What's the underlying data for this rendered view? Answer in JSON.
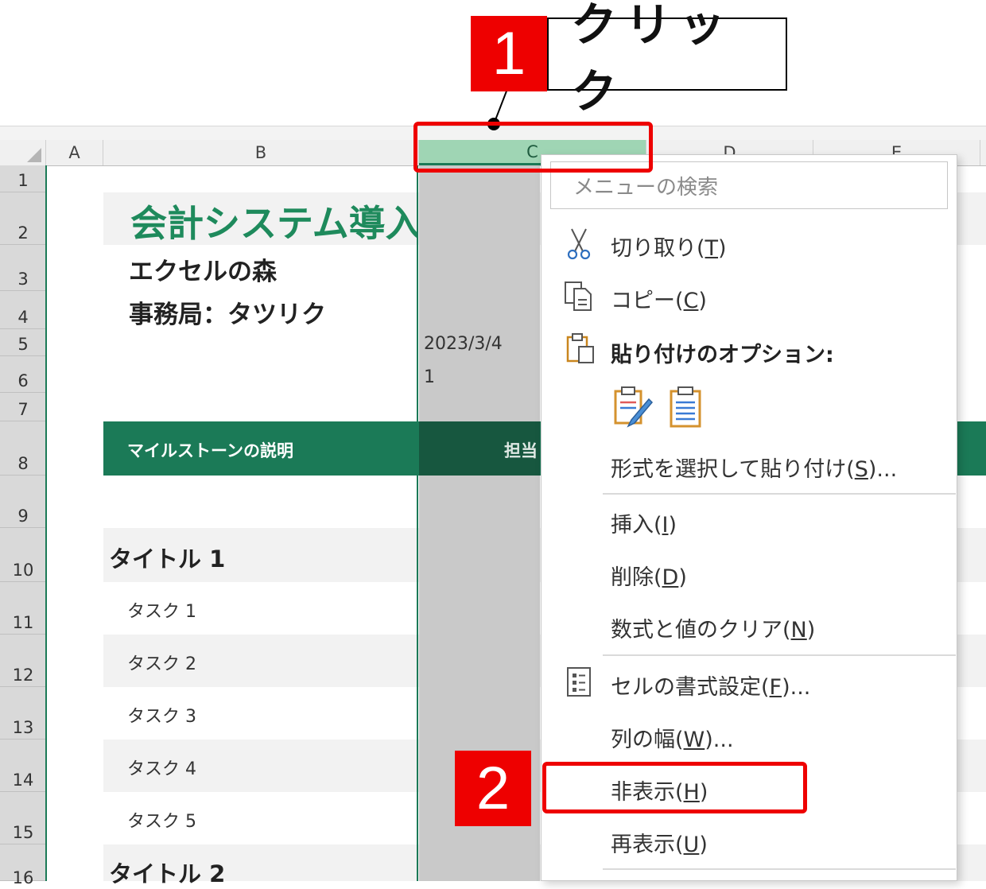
{
  "callouts": {
    "step1": "1",
    "step1_text": "クリック",
    "step2": "2"
  },
  "sheet": {
    "columns": [
      "A",
      "B",
      "C",
      "D",
      "E"
    ],
    "rows": [
      "1",
      "2",
      "3",
      "4",
      "5",
      "6",
      "7",
      "8",
      "9",
      "10",
      "11",
      "12",
      "13",
      "14",
      "15",
      "16"
    ],
    "title": "会計システム導入",
    "org": "エクセルの森",
    "office": "事務局：タツリク",
    "date_value": "2023/3/4",
    "number_value": "1",
    "table_header": "マイルストーンの説明",
    "table_header_c": "担当",
    "section1": "タイトル 1",
    "tasks": [
      "タスク 1",
      "タスク 2",
      "タスク 3",
      "タスク 4",
      "タスク 5"
    ],
    "section2": "タイトル 2"
  },
  "menu": {
    "search_placeholder": "メニューの検索",
    "cut": {
      "label": "切り取り(",
      "key": "T",
      "end": ")"
    },
    "copy": {
      "label": "コピー(",
      "key": "C",
      "end": ")"
    },
    "paste_options": "貼り付けのオプション:",
    "paste_special": {
      "label": "形式を選択して貼り付け(",
      "key": "S",
      "end": ")..."
    },
    "insert": {
      "label": "挿入(",
      "key": "I",
      "end": ")"
    },
    "delete": {
      "label": "削除(",
      "key": "D",
      "end": ")"
    },
    "clear": {
      "label": "数式と値のクリア(",
      "key": "N",
      "end": ")"
    },
    "format_cells": {
      "label": "セルの書式設定(",
      "key": "F",
      "end": ")..."
    },
    "column_width": {
      "label": "列の幅(",
      "key": "W",
      "end": ")..."
    },
    "hide": {
      "label": "非表示(",
      "key": "H",
      "end": ")"
    },
    "unhide": {
      "label": "再表示(",
      "key": "U",
      "end": ")"
    }
  },
  "colors": {
    "accent_red": "#ee0000",
    "excel_green": "#1b7a57",
    "title_green": "#1e8a5c",
    "selected_col_header": "#9fd5b4"
  }
}
